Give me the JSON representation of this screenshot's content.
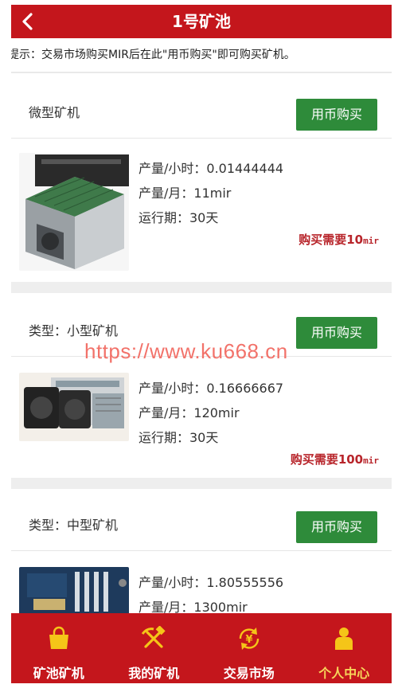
{
  "header": {
    "title": "1号矿池"
  },
  "notice": {
    "text": "提示：交易市场购买MIR后在此\"用币购买\"即可购买矿机。"
  },
  "cards": [
    {
      "type_label": "微型矿机",
      "buy_label": "用币购买",
      "hourly": "产量/小时：0.01444444",
      "monthly": "产量/月：11mir",
      "period": "运行期：30天",
      "price_prefix": "购买需要10",
      "price_unit": "mir"
    },
    {
      "type_label": "类型：小型矿机",
      "buy_label": "用币购买",
      "hourly": "产量/小时：0.16666667",
      "monthly": "产量/月：120mir",
      "period": "运行期：30天",
      "price_prefix": "购买需要100",
      "price_unit": "mir"
    },
    {
      "type_label": "类型：中型矿机",
      "buy_label": "用币购买",
      "hourly": "产量/小时：1.80555556",
      "monthly": "产量/月：1300mir"
    }
  ],
  "watermark": "https://www.ku668.cn",
  "tabbar": {
    "items": [
      {
        "label": "矿池矿机",
        "icon": "shopping-bag-icon",
        "active": false
      },
      {
        "label": "我的矿机",
        "icon": "pickaxe-hammer-icon",
        "active": false
      },
      {
        "label": "交易市场",
        "icon": "yen-exchange-icon",
        "active": false
      },
      {
        "label": "个人中心",
        "icon": "person-icon",
        "active": true
      }
    ]
  },
  "colors": {
    "brand_red": "#c4161c",
    "button_green": "#2e8b3a",
    "price_red": "#b8252b",
    "active_tab": "#f7d55a",
    "icon_yellow": "#f5c518"
  }
}
